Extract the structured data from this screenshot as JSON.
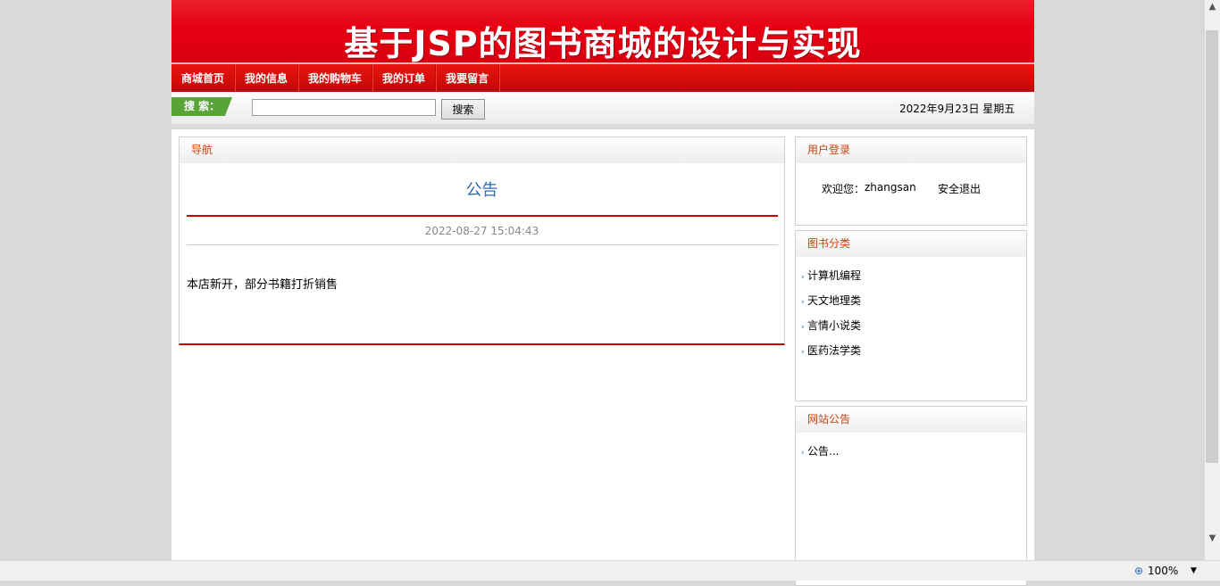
{
  "banner": {
    "title": "基于JSP的图书商城的设计与实现"
  },
  "nav": {
    "items": [
      {
        "label": "商城首页"
      },
      {
        "label": "我的信息"
      },
      {
        "label": "我的购物车"
      },
      {
        "label": "我的订单"
      },
      {
        "label": "我要留言"
      }
    ]
  },
  "search": {
    "label": "搜 索：",
    "placeholder": "",
    "value": "",
    "button": "搜索"
  },
  "date": "2022年9月23日 星期五",
  "main_panel": {
    "header": "导航",
    "notice_title": "公告",
    "notice_time": "2022-08-27 15:04:43",
    "notice_body": "本店新开，部分书籍打折销售"
  },
  "login_panel": {
    "header": "用户登录",
    "welcome": "欢迎您：",
    "username": "zhangsan",
    "logout": "安全退出"
  },
  "category_panel": {
    "header": "图书分类",
    "items": [
      "计算机编程",
      "天文地理类",
      "言情小说类",
      "医药法学类"
    ]
  },
  "news_panel": {
    "header": "网站公告",
    "items": [
      "公告..."
    ]
  },
  "statusbar": {
    "zoom": "100%"
  },
  "colors": {
    "brand_red": "#e60012",
    "nav_red": "#d40d0a",
    "search_green": "#5aa336",
    "panel_title": "#c9440f",
    "notice_blue": "#2d6bb5"
  },
  "icons": {
    "bullet": "chevron-right-icon",
    "zoom": "zoom-icon"
  }
}
